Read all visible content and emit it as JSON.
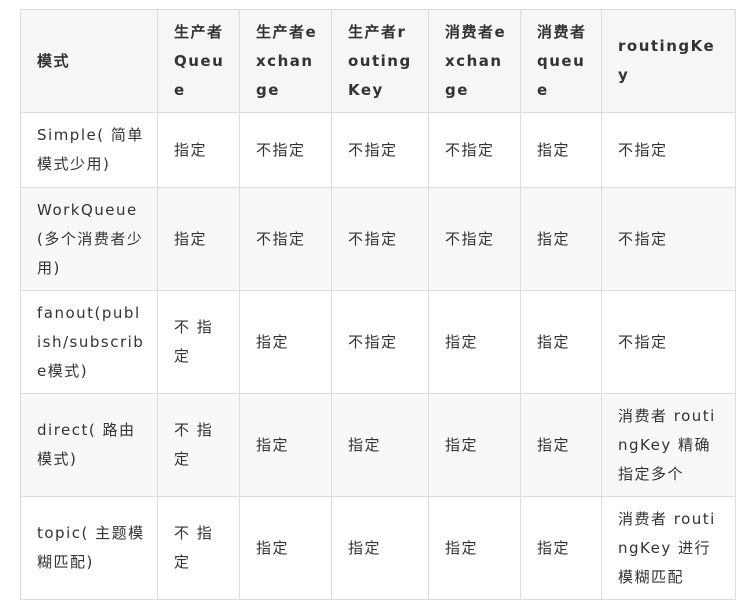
{
  "table": {
    "headers": [
      "模式",
      "生产者Queue",
      "生产者exchange",
      "生产者routingKey",
      "消费者exchange",
      "消费者queue",
      "routingKey"
    ],
    "rows": [
      [
        "Simple( 简单模式少用)",
        "指定",
        "不指定",
        "不指定",
        "不指定",
        "指定",
        "不指定"
      ],
      [
        "WorkQueue(多个消费者少用)",
        "指定",
        "不指定",
        "不指定",
        "不指定",
        "指定",
        "不指定"
      ],
      [
        "fanout(publish/subscribe模式)",
        "不 指 定",
        "指定",
        "不指定",
        "指定",
        "指定",
        "不指定"
      ],
      [
        "direct( 路由模式)",
        "不 指 定",
        "指定",
        "指定",
        "指定",
        "指定",
        "消费者 routingKey 精确指定多个"
      ],
      [
        "topic( 主题模糊匹配)",
        "不 指 定",
        "指定",
        "指定",
        "指定",
        "指定",
        "消费者 routingKey 进行模糊匹配"
      ]
    ]
  }
}
